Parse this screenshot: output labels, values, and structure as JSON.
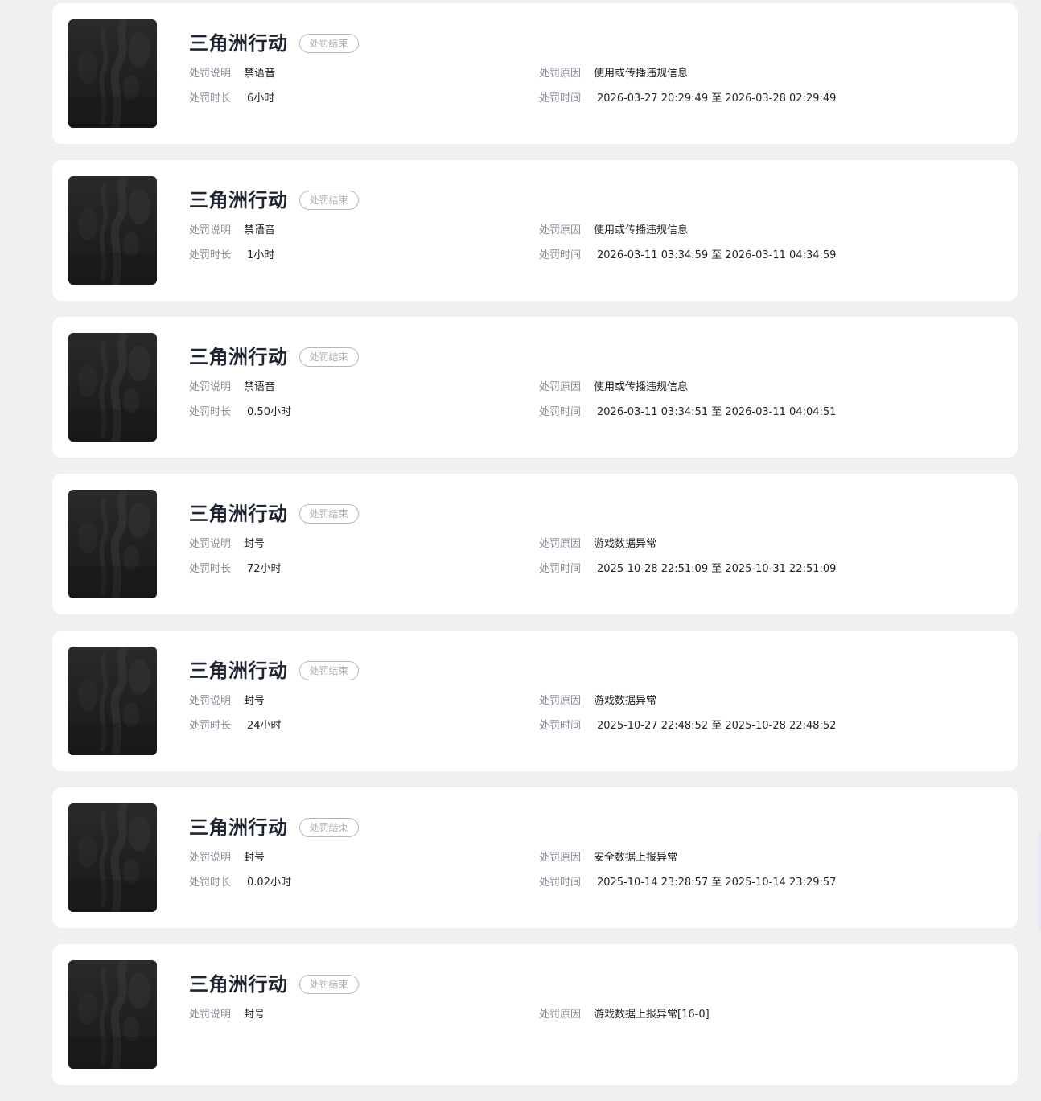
{
  "labels": {
    "description": "处罚说明",
    "reason": "处罚原因",
    "duration": "处罚时长",
    "time": "处罚时间"
  },
  "records": [
    {
      "game": "三角洲行动",
      "status": "处罚结束",
      "description": "禁语音",
      "reason": "使用或传播违规信息",
      "duration": "6小时",
      "time": "2026-03-27 20:29:49 至 2026-03-28 02:29:49"
    },
    {
      "game": "三角洲行动",
      "status": "处罚结束",
      "description": "禁语音",
      "reason": "使用或传播违规信息",
      "duration": "1小时",
      "time": "2026-03-11 03:34:59 至 2026-03-11 04:34:59"
    },
    {
      "game": "三角洲行动",
      "status": "处罚结束",
      "description": "禁语音",
      "reason": "使用或传播违规信息",
      "duration": "0.50小时",
      "time": "2026-03-11 03:34:51 至 2026-03-11 04:04:51"
    },
    {
      "game": "三角洲行动",
      "status": "处罚结束",
      "description": "封号",
      "reason": "游戏数据异常",
      "duration": "72小时",
      "time": "2025-10-28 22:51:09 至 2025-10-31 22:51:09"
    },
    {
      "game": "三角洲行动",
      "status": "处罚结束",
      "description": "封号",
      "reason": "游戏数据异常",
      "duration": "24小时",
      "time": "2025-10-27 22:48:52 至 2025-10-28 22:48:52"
    },
    {
      "game": "三角洲行动",
      "status": "处罚结束",
      "description": "封号",
      "reason": "安全数据上报异常",
      "duration": "0.02小时",
      "time": "2025-10-14 23:28:57 至 2025-10-14 23:29:57"
    },
    {
      "game": "三角洲行动",
      "status": "处罚结束",
      "description": "封号",
      "reason": "游戏数据上报异常[16-0]",
      "duration": "",
      "time": ""
    }
  ]
}
